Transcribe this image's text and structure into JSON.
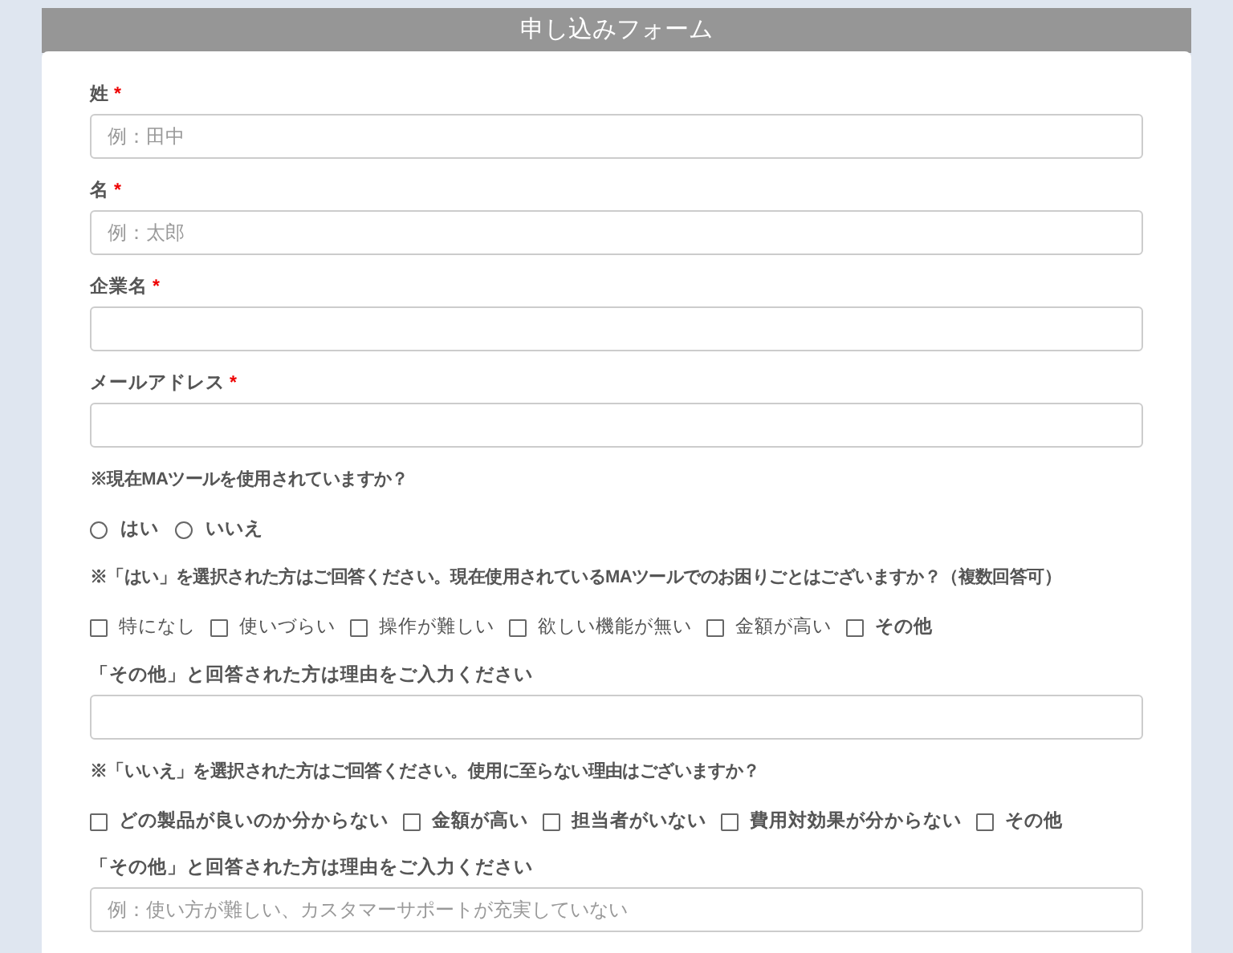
{
  "form": {
    "title": "申し込みフォーム",
    "items": [
      {
        "kind": "field",
        "label": "姓",
        "required_mark": "*",
        "placeholder": "例：田中"
      },
      {
        "kind": "field",
        "label": "名",
        "required_mark": "*",
        "placeholder": "例：太郎"
      },
      {
        "kind": "field",
        "label": "企業名",
        "required_mark": "*"
      },
      {
        "kind": "field",
        "label": "メールアドレス",
        "required_mark": "*"
      },
      {
        "kind": "question",
        "text": "※現在MAツールを使用されていますか？"
      },
      {
        "kind": "radios",
        "options": [
          {
            "label": "はい",
            "selected": false
          },
          {
            "label": "いいえ",
            "selected": false
          }
        ]
      },
      {
        "kind": "question",
        "text": "※「はい」を選択された方はご回答ください。現在使用されているMAツールでのお困りごとはございますか？（複数回答可）"
      },
      {
        "kind": "checkboxes",
        "options": [
          {
            "label": "特になし",
            "checked": false,
            "bold": false
          },
          {
            "label": "使いづらい",
            "checked": false,
            "bold": false
          },
          {
            "label": "操作が難しい",
            "checked": false,
            "bold": false
          },
          {
            "label": "欲しい機能が無い",
            "checked": false,
            "bold": false
          },
          {
            "label": "金額が高い",
            "checked": false,
            "bold": false
          },
          {
            "label": "その他",
            "checked": false,
            "bold": true
          }
        ]
      },
      {
        "kind": "field",
        "label": "「その他」と回答された方は理由をご入力ください"
      },
      {
        "kind": "question",
        "text": "※「いいえ」を選択された方はご回答ください。使用に至らない理由はございますか？"
      },
      {
        "kind": "checkboxes",
        "options": [
          {
            "label": "どの製品が良いのか分からない",
            "checked": false,
            "bold": true
          },
          {
            "label": "金額が高い",
            "checked": false,
            "bold": true
          },
          {
            "label": "担当者がいない",
            "checked": false,
            "bold": true
          },
          {
            "label": "費用対効果が分からない",
            "checked": false,
            "bold": true
          },
          {
            "label": "その他",
            "checked": false,
            "bold": true
          }
        ]
      },
      {
        "kind": "field",
        "label": "「その他」と回答された方は理由をご入力ください",
        "placeholder": "例：使い方が難しい、カスタマーサポートが充実していない"
      }
    ]
  }
}
